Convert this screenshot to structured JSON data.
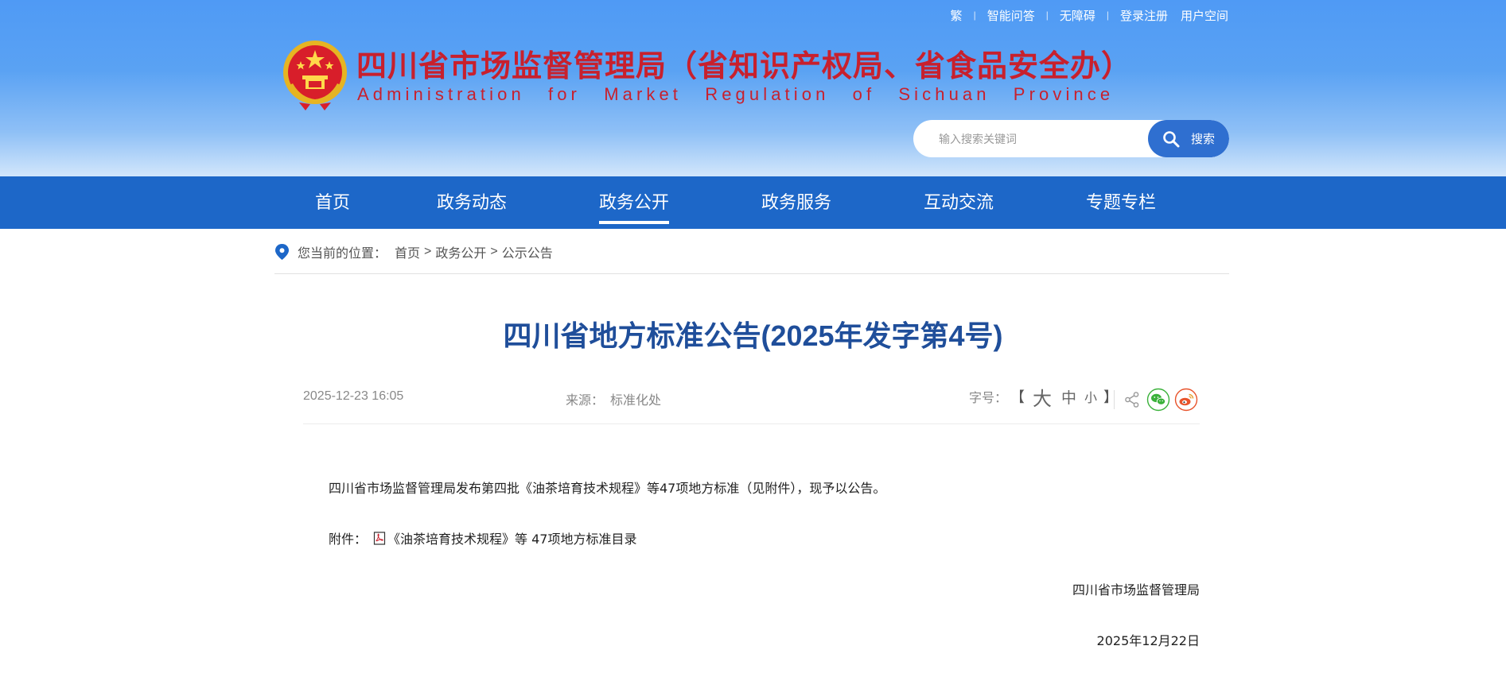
{
  "top_links": {
    "traditional": "繁",
    "smart_qa": "智能问答",
    "accessibility": "无障碍",
    "login_register": "登录注册",
    "user_space": "用户空间"
  },
  "header": {
    "title": "四川省市场监督管理局（省知识产权局、省食品安全办）",
    "subtitle": "Administration for Market Regulation of Sichuan Province"
  },
  "search": {
    "placeholder": "输入搜索关键词",
    "button_label": "搜索"
  },
  "nav": {
    "items": [
      {
        "label": "首页",
        "active": false
      },
      {
        "label": "政务动态",
        "active": false
      },
      {
        "label": "政务公开",
        "active": true
      },
      {
        "label": "政务服务",
        "active": false
      },
      {
        "label": "互动交流",
        "active": false
      },
      {
        "label": "专题专栏",
        "active": false
      }
    ]
  },
  "breadcrumb": {
    "label": "您当前的位置：",
    "items": [
      "首页",
      "政务公开",
      "公示公告"
    ],
    "separator": ">"
  },
  "article": {
    "title": "四川省地方标准公告(2025年发字第4号)",
    "date": "2025-12-23 16:05",
    "source_label": "来源：",
    "source_value": "标准化处",
    "font_label": "字号：",
    "font_open": "【",
    "font_large": "大",
    "font_medium": "中",
    "font_small": "小",
    "font_close": "】",
    "body": "四川省市场监督管理局发布第四批《油茶培育技术规程》等47项地方标准（见附件），现予以公告。",
    "attachment_label": "附件：",
    "attachment_link": "《油茶培育技术规程》等 47项地方标准目录",
    "signature": "四川省市场监督管理局",
    "sign_date": "2025年12月22日"
  },
  "colors": {
    "nav_bg": "#1d67c8",
    "title_blue": "#1f4e9a",
    "header_red": "#c8202d",
    "wechat_green": "#3ab13a",
    "weibo_orange": "#e8532b"
  },
  "icons": [
    "national-emblem",
    "search-icon",
    "location-pin-icon",
    "share-icon",
    "wechat-icon",
    "weibo-icon",
    "pdf-icon"
  ]
}
